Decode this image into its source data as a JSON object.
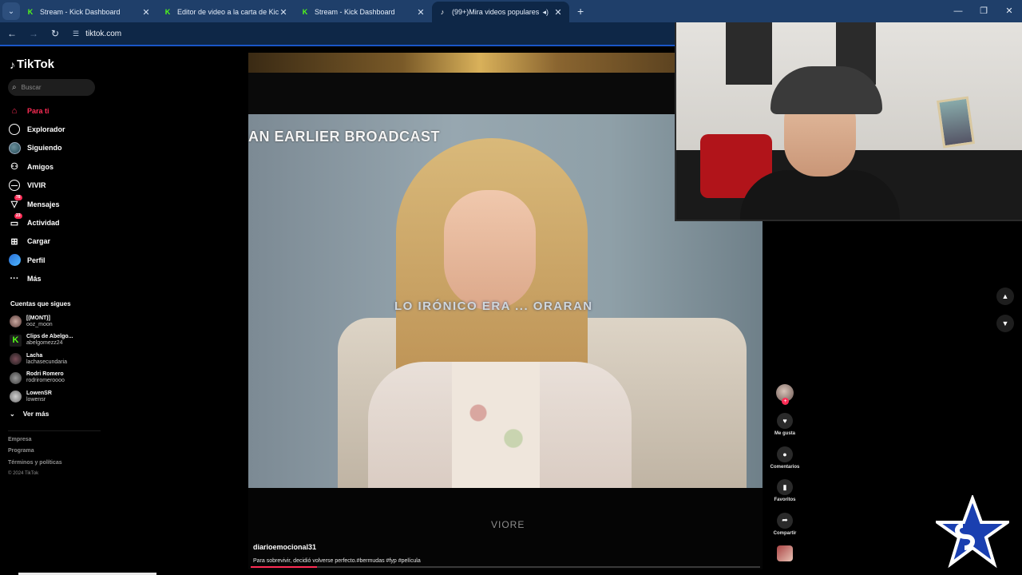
{
  "browser": {
    "tabs": [
      {
        "title": "Stream - Kick Dashboard",
        "favicon": "kick-logo-icon",
        "active": false
      },
      {
        "title": "Editor de video a la carta de Kick",
        "favicon": "kick-logo-icon",
        "active": false
      },
      {
        "title": "Stream - Kick Dashboard",
        "favicon": "kick-logo-icon",
        "active": false
      },
      {
        "title": "(99+)Mira videos populares",
        "favicon": "tiktok-logo-icon",
        "active": true
      }
    ],
    "url": "tiktok.com"
  },
  "tiktok": {
    "logo_text": "TikTok",
    "search_placeholder": "Buscar",
    "nav": [
      {
        "label": "Para ti",
        "icon": "home-icon",
        "active": true
      },
      {
        "label": "Explorador",
        "icon": "compass-icon"
      },
      {
        "label": "Siguiendo",
        "icon": "following-avatar-icon"
      },
      {
        "label": "Amigos",
        "icon": "friends-icon"
      },
      {
        "label": "VIVIR",
        "icon": "live-icon"
      },
      {
        "label": "Mensajes",
        "icon": "messages-icon",
        "badge": "78"
      },
      {
        "label": "Actividad",
        "icon": "activity-icon",
        "badge": "23"
      },
      {
        "label": "Cargar",
        "icon": "upload-icon"
      },
      {
        "label": "Perfil",
        "icon": "profile-avatar-icon"
      },
      {
        "label": "Más",
        "icon": "more-icon"
      }
    ],
    "following_title": "Cuentas que sigues",
    "following": [
      {
        "name": "[(MONT)]",
        "user": "ooz_moon"
      },
      {
        "name": "Clips de Abelgo...",
        "user": "abelgomezz24"
      },
      {
        "name": "Lacha",
        "user": "lachasecundaria"
      },
      {
        "name": "Rodri Romero",
        "user": "rodriromeroooo"
      },
      {
        "name": "LowenSR",
        "user": "lowensr"
      }
    ],
    "see_more": "Ver más",
    "footer": [
      "Empresa",
      "Programa",
      "Términos y políticas",
      "© 2024 TikTok"
    ]
  },
  "video": {
    "overlay_text": "AN EARLIER BROADCAST",
    "subtitle": "LO IRÓNICO ERA ... ORARAN",
    "watermark": "VIORE",
    "author": "diarioemocional31",
    "caption": "Para sobrevivir, decidió volverse perfecto.#bermudas #fyp #película",
    "progress": 0.13
  },
  "actions": [
    {
      "label": "Me gusta",
      "icon": "heart-icon"
    },
    {
      "label": "Comentarios",
      "icon": "comment-icon"
    },
    {
      "label": "Favoritos",
      "icon": "bookmark-icon"
    },
    {
      "label": "Compartir",
      "icon": "share-icon"
    }
  ],
  "colors": {
    "accent": "#fe2c55",
    "kick": "#53fc18",
    "chrome": "#1f3f6a"
  }
}
